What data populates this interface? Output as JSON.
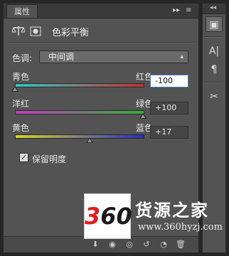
{
  "panel": {
    "tab_label": "属性",
    "adjustment_title": "色彩平衡",
    "menu_icons": [
      "expand-icon",
      "menu-icon"
    ]
  },
  "tone": {
    "label": "色调:",
    "selected": "中间调"
  },
  "sliders": [
    {
      "left": "青色",
      "right": "红色",
      "value": "-100",
      "level": -100,
      "colors": [
        "#2fc2c2",
        "#c23131"
      ]
    },
    {
      "left": "洋红",
      "right": "绿色",
      "value": "+100",
      "level": 100,
      "colors": [
        "#c23cc2",
        "#33b233"
      ]
    },
    {
      "left": "黄色",
      "right": "蓝色",
      "value": "+17",
      "level": 17,
      "colors": [
        "#d6d62c",
        "#2b2bc7"
      ]
    }
  ],
  "preserve": {
    "label": "保留明度",
    "checked": true
  },
  "strip_tools": [
    "layers-icon",
    "character-icon",
    "paragraph-icon",
    "tools-icon"
  ],
  "watermark": {
    "logo": "360",
    "brand": "货源之家",
    "url": "www.360hyzj.com"
  }
}
